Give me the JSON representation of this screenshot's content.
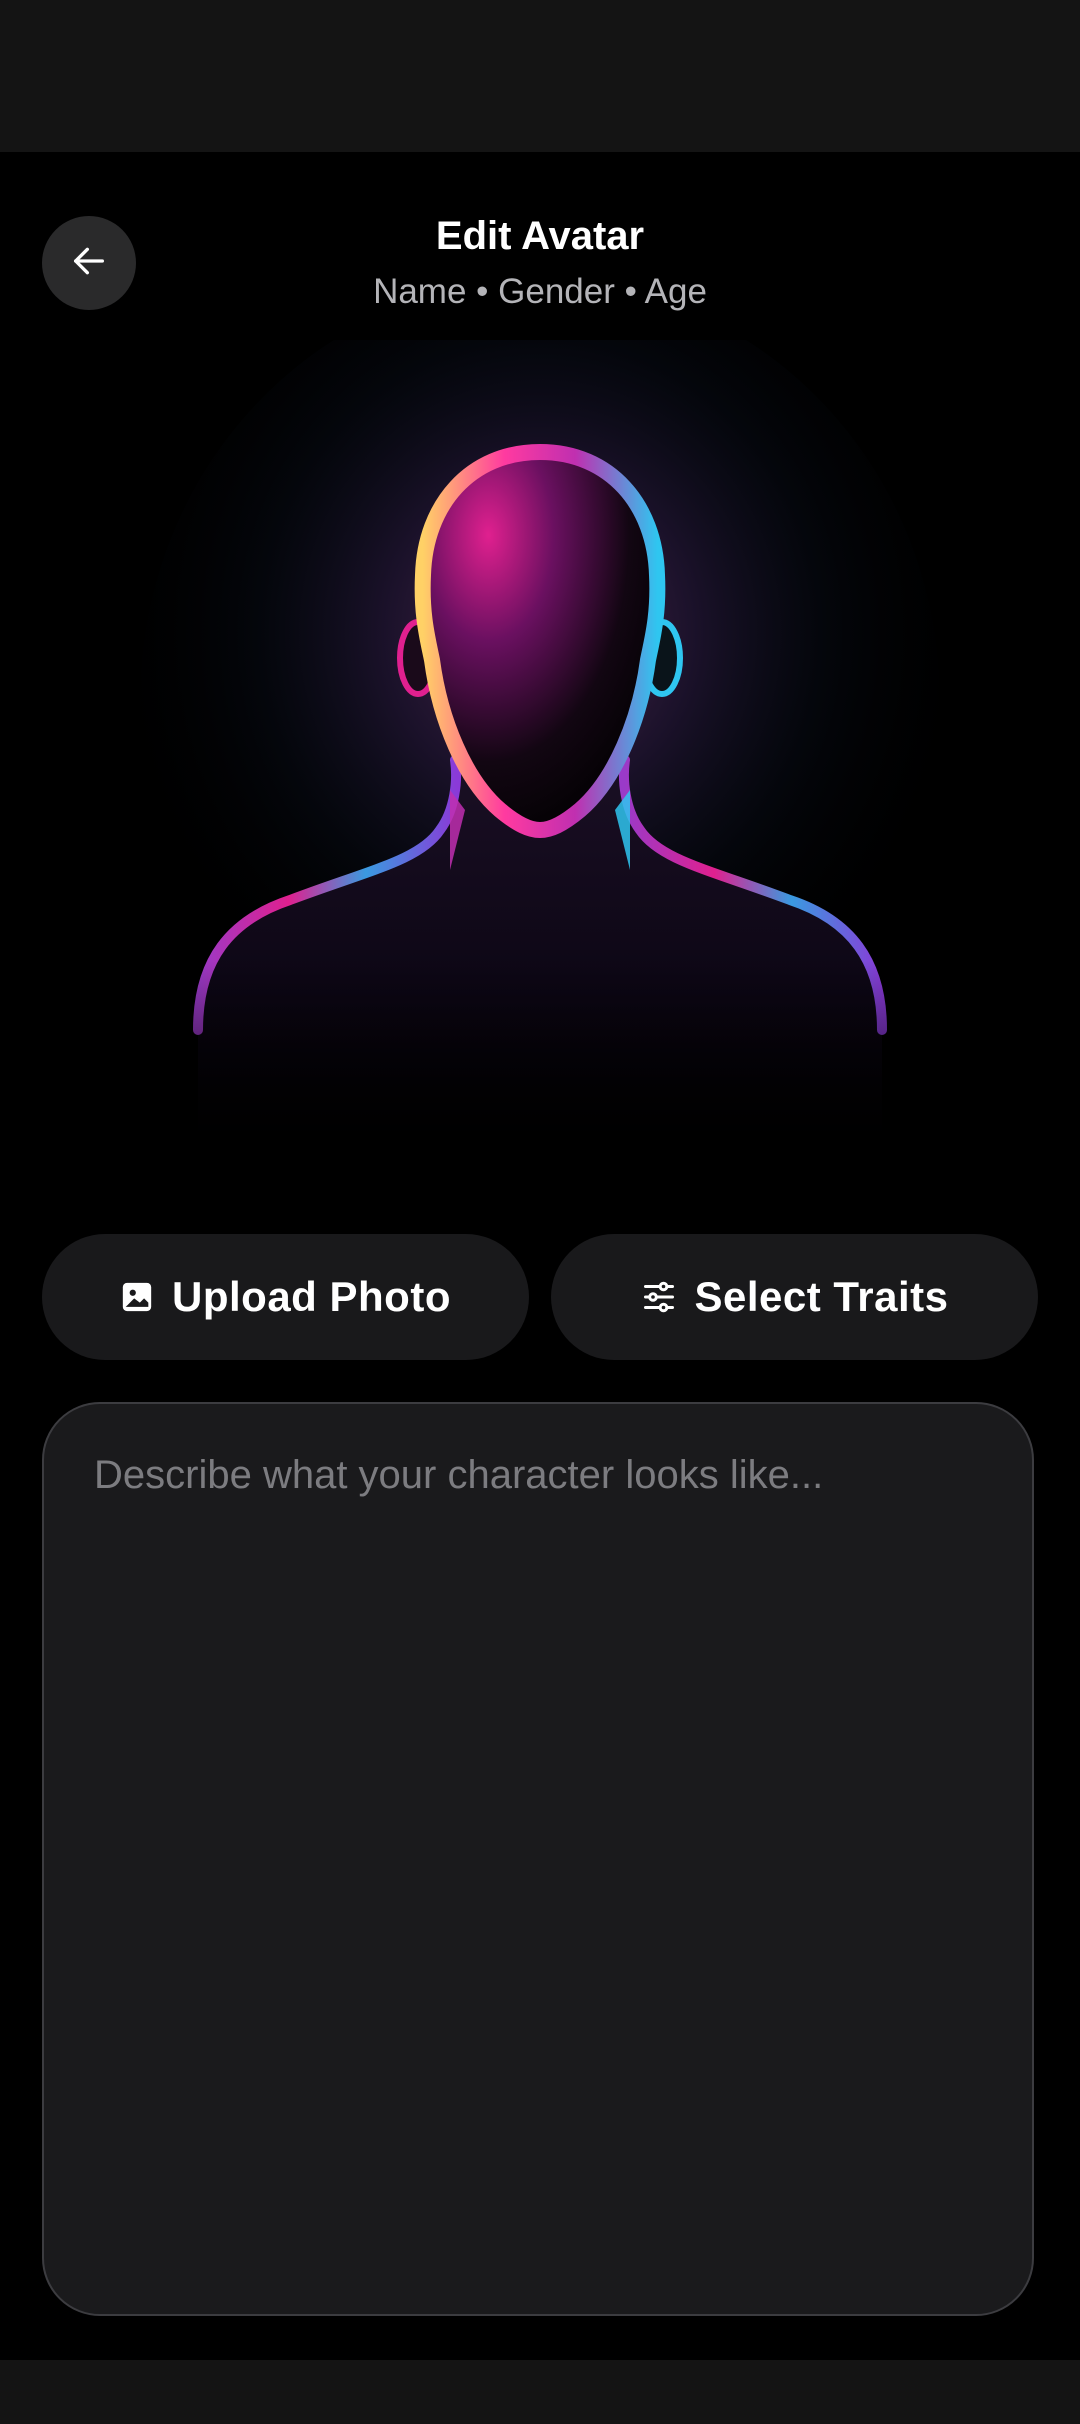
{
  "header": {
    "title": "Edit Avatar",
    "subtitle": "Name • Gender • Age"
  },
  "back_button": {
    "icon": "arrow-left-icon"
  },
  "avatar": {
    "icon": "glowing-silhouette-avatar",
    "colors": {
      "glow_magenta": "#e0208f",
      "glow_yellow": "#ffd166",
      "glow_cyan": "#2fc6f0",
      "glow_purple": "#8a3ad8"
    }
  },
  "actions": {
    "upload": {
      "label": "Upload Photo",
      "icon": "image-icon"
    },
    "traits": {
      "label": "Select Traits",
      "icon": "sliders-icon"
    }
  },
  "description": {
    "placeholder": "Describe what your character looks like...",
    "value": ""
  },
  "colors": {
    "background": "#000000",
    "surface": "#19191b",
    "field_border": "#3c3c40",
    "subtitle_text": "#b4b4b8",
    "placeholder_text": "#7c7c80"
  }
}
